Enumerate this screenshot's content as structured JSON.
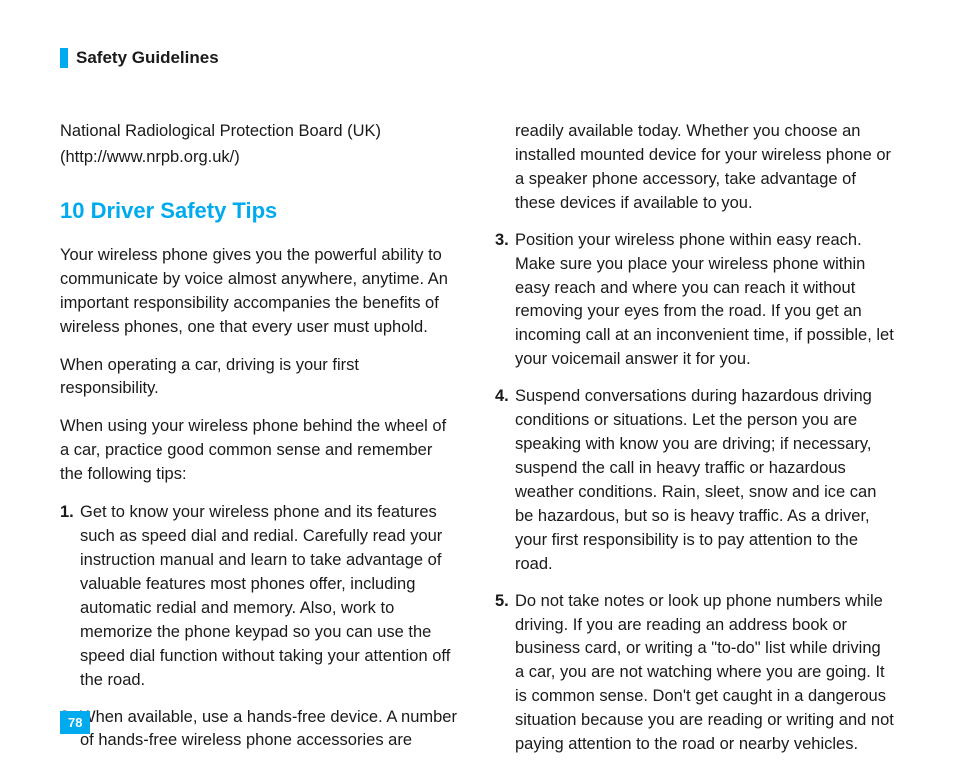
{
  "header": {
    "title": "Safety Guidelines"
  },
  "intro": {
    "line1": "National Radiological Protection Board (UK)",
    "line2": "(http://www.nrpb.org.uk/)"
  },
  "section_heading": "10 Driver Safety Tips",
  "paragraphs": {
    "p1": "Your wireless phone gives you the powerful ability to communicate by voice almost anywhere, anytime. An important responsibility accompanies the benefits of wireless phones, one that every user must uphold.",
    "p2": "When operating a car, driving is your first responsibility.",
    "p3": "When using your wireless phone behind the wheel of a car, practice good common sense and remember the following tips:"
  },
  "tips": {
    "t1": {
      "num": "1.",
      "text": "Get to know your wireless phone and its features such as speed dial and redial. Carefully read your instruction manual and learn to take advantage of valuable features most phones offer, including automatic redial and memory. Also, work to memorize the phone keypad so you can use the speed dial function without taking your attention off the road."
    },
    "t2": {
      "num": "2.",
      "text_a": "When available, use a hands-free device. A number of hands-free wireless phone accessories are",
      "text_b": "readily available today. Whether you choose an installed mounted device for your wireless phone or a speaker phone accessory, take advantage of these devices if available to you."
    },
    "t3": {
      "num": "3.",
      "text": "Position your wireless phone within easy reach. Make sure you place your wireless phone within easy reach and where you can reach it without removing your eyes from the road. If you get an incoming call at an inconvenient time, if possible, let your voicemail answer it for you."
    },
    "t4": {
      "num": "4.",
      "text": "Suspend conversations during hazardous driving conditions or situations. Let the person you are speaking with know you are driving; if necessary, suspend the call in heavy traffic or hazardous weather conditions. Rain, sleet, snow and ice can be hazardous, but so is heavy traffic. As a driver, your first responsibility is to pay attention to the road."
    },
    "t5": {
      "num": "5.",
      "text": "Do not take notes or look up phone numbers while driving. If you are reading an address book or business card, or writing a \"to-do\" list while driving a car, you are not watching where you are going. It is common sense. Don't get caught in a dangerous situation because you are reading or writing and not paying attention to the road or nearby vehicles."
    }
  },
  "page_number": "78"
}
